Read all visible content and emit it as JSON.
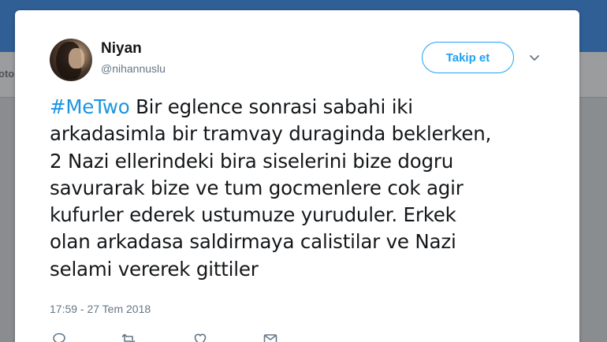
{
  "background": {
    "nav_fragment": "oto"
  },
  "tweet": {
    "author_name": "Niyan",
    "author_handle": "@nihannuslu",
    "follow_label": "Takip et",
    "hashtag": "#MeTwo",
    "body_lines": [
      " Bir eglence sonrasi sabahi iki",
      "arkadasimla bir tramvay duraginda beklerken,",
      "2 Nazi ellerindeki bira siselerini bize dogru",
      "savurarak bize ve tum gocmenlere cok agir",
      "kufurler ederek ustumuze yuruduler. Erkek",
      "olan arkadasa saldirmaya calistilar ve Nazi",
      "selami vererek gittiler"
    ],
    "timestamp": "17:59 - 27 Tem 2018",
    "actions": [
      "reply-icon",
      "retweet-icon",
      "like-icon",
      "message-icon"
    ]
  },
  "colors": {
    "accent": "#1da1f2",
    "hashtag": "#1b95e0",
    "header": "#2f5f95"
  }
}
